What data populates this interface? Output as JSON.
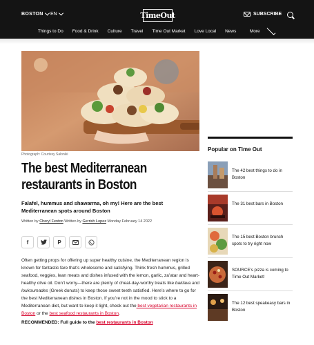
{
  "header": {
    "city": "BOSTON",
    "language": "EN",
    "logo": "TimeOut",
    "subscribe": "SUBSCRIBE"
  },
  "nav": {
    "items": [
      "Things to Do",
      "Food & Drink",
      "Culture",
      "Travel",
      "Time Out Market",
      "Love Local",
      "News"
    ],
    "more": "More"
  },
  "article": {
    "photo_credit": "Photograph: Courtesy Saloniki",
    "title": "The best Mediterranean restaurants in Boston",
    "dek": "Falafel, hummus and shawarma, oh my! Here are the best Mediterranean spots around Boston",
    "byline": {
      "written_by": "Written by",
      "author1": "Cheryl Fenton",
      "and": "Written by",
      "author2": "Gerrish Lopez",
      "date": "Monday February 14 2022"
    },
    "body_1": "Often getting props for offering up super healthy cuisine, the Mediterranean region is known for fantastic fare that’s wholesome and satisfying. Think fresh hummus, grilled seafood, veggies, lean meats and dishes infused with the lemon, garlic, za’atar and heart-healthy olive oil. Don’t worry—there are plenty of cheat-day-worthy treats like ",
    "baklava": "baklava",
    "and_word": " and ",
    "loukoumades": "loukoumades",
    "body_2": " (Greek donuts) to keep those sweet teeth satisfied. Here’s where to go for the best Mediterranean dishes in Boston. If you’re not in the mood to stick to a Mediterranean diet, but want to keep it light, check out the",
    "link_veg": " best vegetarian restaurants in Boston",
    "or_the": " or the ",
    "link_seafood": "best seafood restaurants in Boston",
    "period": ".",
    "recommended_label": "RECOMMENDED: Full guide to the ",
    "recommended_link": "best restaurants in Boston"
  },
  "sidebar": {
    "heading": "Popular on Time Out",
    "items": [
      {
        "label": "The 42 best things to do in Boston"
      },
      {
        "label": "The 31 best bars in Boston"
      },
      {
        "label": "The 15 best Boston brunch spots to try right now"
      },
      {
        "label": "SOURCE’s pizza is coming to Time Out Market!"
      },
      {
        "label": "The 12 best speakeasy bars in Boston"
      }
    ]
  },
  "colors": {
    "header_bg": "#141414",
    "link_red": "#d6002a"
  }
}
